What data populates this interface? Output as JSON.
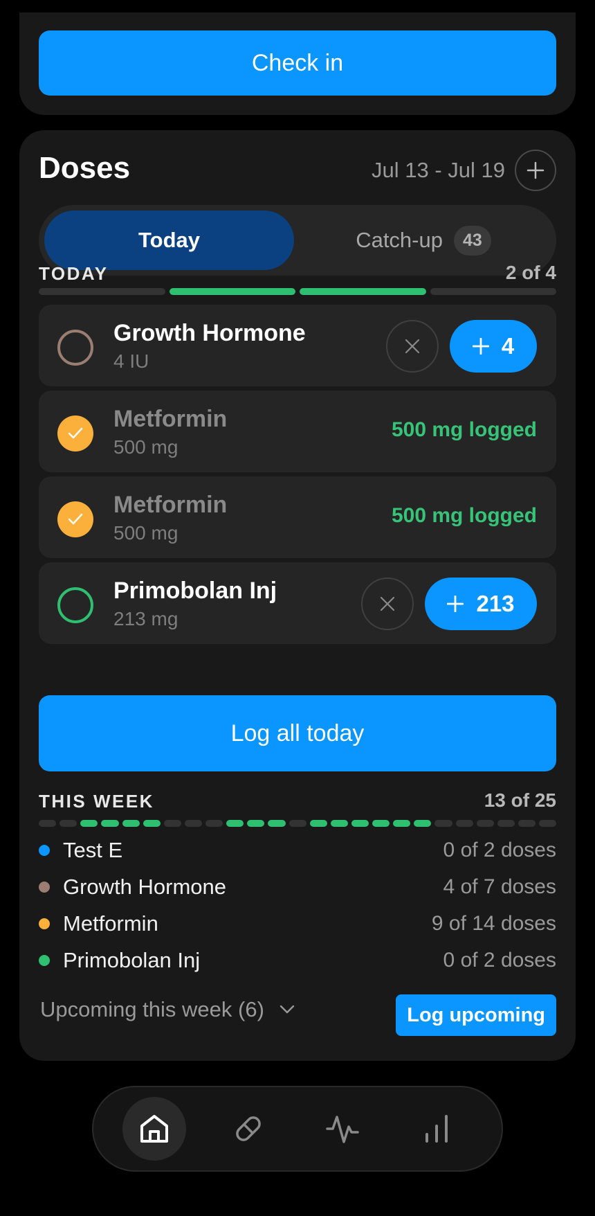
{
  "checkin": {
    "label": "Check in"
  },
  "doses": {
    "title": "Doses",
    "date_range": "Jul 13 - Jul 19",
    "tabs": {
      "today": "Today",
      "catchup": "Catch-up",
      "catchup_count": "43"
    },
    "today_section": {
      "label": "TODAY",
      "count": "2 of 4",
      "completed": 2,
      "total": 4
    },
    "items": [
      {
        "name": "Growth Hormone",
        "amount": "4 IU",
        "status": "pending",
        "add_label": "4",
        "ring_color": "#9a7e72"
      },
      {
        "name": "Metformin",
        "amount": "500 mg",
        "status": "logged",
        "logged_text": "500 mg logged"
      },
      {
        "name": "Metformin",
        "amount": "500 mg",
        "status": "logged",
        "logged_text": "500 mg logged"
      },
      {
        "name": "Primobolan Inj",
        "amount": "213 mg",
        "status": "pending",
        "add_label": "213",
        "ring_color": "#2fbf71"
      }
    ],
    "log_all_label": "Log all today",
    "week_section": {
      "label": "THIS WEEK",
      "count": "13 of 25",
      "completed": 13,
      "total": 25
    },
    "week_breakdown": [
      {
        "name": "Test E",
        "count": "0 of 2 doses",
        "color": "#0a95ff"
      },
      {
        "name": "Growth Hormone",
        "count": "4 of 7 doses",
        "color": "#9a7e72"
      },
      {
        "name": "Metformin",
        "count": "9 of 14 doses",
        "color": "#fbb03b"
      },
      {
        "name": "Primobolan Inj",
        "count": "0 of 2 doses",
        "color": "#2fbf71"
      }
    ],
    "upcoming_label": "Upcoming this week (6)",
    "log_upcoming_label": "Log upcoming"
  },
  "nav": {
    "items": [
      {
        "icon": "home-icon",
        "active": true
      },
      {
        "icon": "pill-icon",
        "active": false
      },
      {
        "icon": "activity-icon",
        "active": false
      },
      {
        "icon": "stats-icon",
        "active": false
      }
    ]
  },
  "colors": {
    "accent": "#0a95ff",
    "success": "#2fbf71",
    "warning": "#fbb03b",
    "segment_active": "#0b4181"
  }
}
